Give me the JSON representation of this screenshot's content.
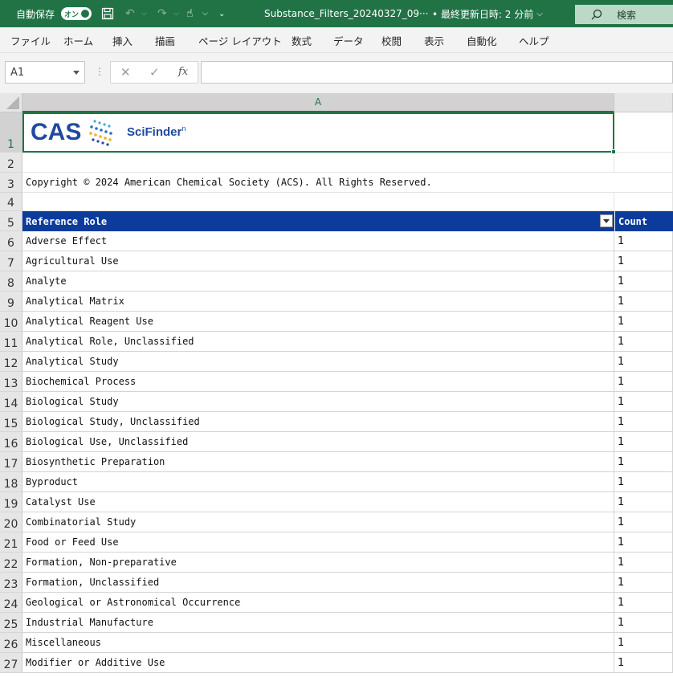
{
  "titlebar": {
    "autosave_label": "自動保存",
    "autosave_toggle": "オン",
    "filename": "Substance_Filters_20240327_09···",
    "saved_info": "• 最終更新日時: 2 分前",
    "search_label": "検索"
  },
  "menu": [
    "ファイル",
    "ホーム",
    "挿入",
    "描画",
    "ページ レイアウト",
    "数式",
    "データ",
    "校閲",
    "表示",
    "自動化",
    "ヘルプ"
  ],
  "formula_bar": {
    "name_box": "A1",
    "cancel_symbol": "✕",
    "enter_symbol": "✓",
    "fx_label": "fx",
    "dots": "⋮",
    "formula_value": ""
  },
  "grid": {
    "columns": [
      "A"
    ],
    "rows": [
      "1",
      "2",
      "3",
      "4",
      "5",
      "6",
      "7",
      "8",
      "9",
      "10",
      "11",
      "12",
      "13",
      "14",
      "15",
      "16",
      "17",
      "18",
      "19",
      "20",
      "21",
      "22",
      "23",
      "24",
      "25",
      "26",
      "27"
    ],
    "logo": {
      "cas": "CAS",
      "scifinder": "SciFinder",
      "scifinder_sup": "n"
    },
    "copyright": "Copyright © 2024 American Chemical Society (ACS).  All Rights Reserved.",
    "table_headers": {
      "role": "Reference Role",
      "count": "Count"
    },
    "table_rows": [
      {
        "role": "Adverse Effect",
        "count": "1"
      },
      {
        "role": "Agricultural Use",
        "count": "1"
      },
      {
        "role": "Analyte",
        "count": "1"
      },
      {
        "role": "Analytical Matrix",
        "count": "1"
      },
      {
        "role": "Analytical Reagent Use",
        "count": "1"
      },
      {
        "role": "Analytical Role, Unclassified",
        "count": "1"
      },
      {
        "role": "Analytical Study",
        "count": "1"
      },
      {
        "role": "Biochemical Process",
        "count": "1"
      },
      {
        "role": "Biological Study",
        "count": "1"
      },
      {
        "role": "Biological Study, Unclassified",
        "count": "1"
      },
      {
        "role": "Biological Use, Unclassified",
        "count": "1"
      },
      {
        "role": "Biosynthetic Preparation",
        "count": "1"
      },
      {
        "role": "Byproduct",
        "count": "1"
      },
      {
        "role": "Catalyst Use",
        "count": "1"
      },
      {
        "role": "Combinatorial Study",
        "count": "1"
      },
      {
        "role": "Food or Feed Use",
        "count": "1"
      },
      {
        "role": "Formation, Non-preparative",
        "count": "1"
      },
      {
        "role": "Formation, Unclassified",
        "count": "1"
      },
      {
        "role": "Geological or Astronomical Occurrence",
        "count": "1"
      },
      {
        "role": "Industrial Manufacture",
        "count": "1"
      },
      {
        "role": "Miscellaneous",
        "count": "1"
      },
      {
        "role": "Modifier or Additive Use",
        "count": "1"
      }
    ]
  },
  "colors": {
    "excel_green": "#217346",
    "header_blue": "#0b3c9c",
    "cas_blue": "#1f4aa0"
  }
}
